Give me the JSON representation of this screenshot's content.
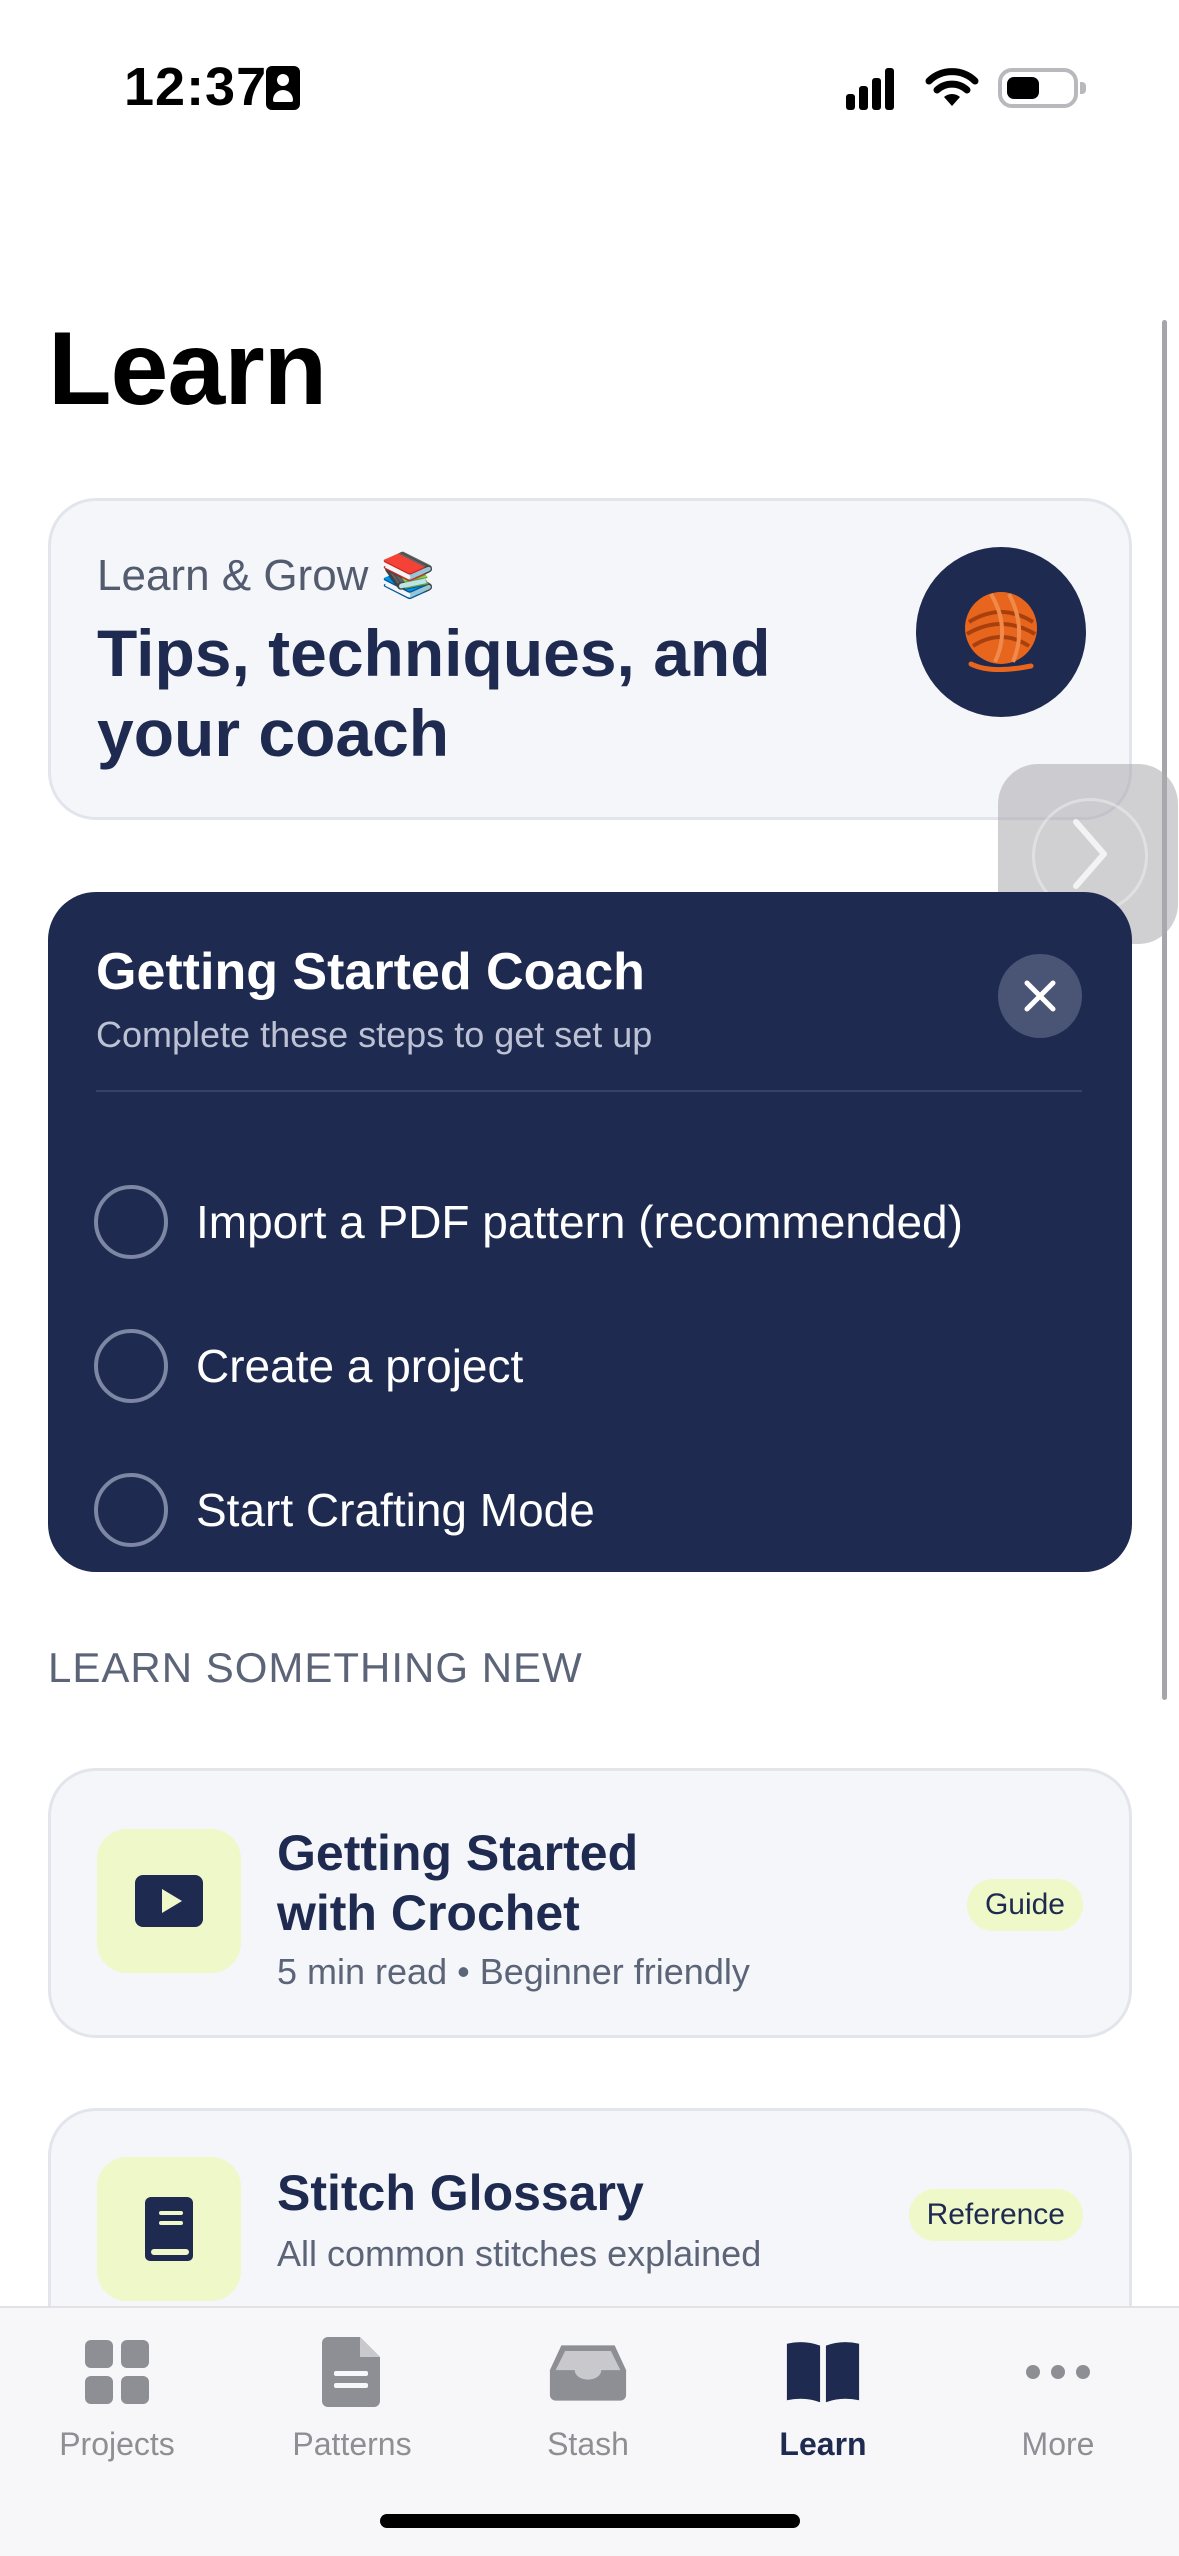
{
  "status_bar": {
    "time": "12:37"
  },
  "page": {
    "title": "Learn"
  },
  "hero": {
    "kicker": "Learn & Grow 📚",
    "title": "Tips, techniques, and your coach",
    "avatar_icon": "yarn-ball-icon"
  },
  "coach": {
    "title": "Getting Started Coach",
    "subtitle": "Complete these steps to get set up",
    "steps": [
      {
        "label": "Import a PDF pattern (recommended)",
        "done": false
      },
      {
        "label": "Create a project",
        "done": false
      },
      {
        "label": "Start Crafting Mode",
        "done": false
      }
    ]
  },
  "learn_section": {
    "header": "LEARN SOMETHING NEW",
    "items": [
      {
        "title_line1": "Getting Started",
        "title_line2": "with Crochet",
        "meta": "5 min read • Beginner friendly",
        "badge": "Guide",
        "icon": "play-icon"
      },
      {
        "title_line1": "Stitch Glossary",
        "meta": "All common stitches explained",
        "badge": "Reference",
        "icon": "book-icon"
      }
    ]
  },
  "tab_bar": {
    "tabs": [
      {
        "label": "Projects",
        "icon": "grid-icon",
        "active": false
      },
      {
        "label": "Patterns",
        "icon": "document-icon",
        "active": false
      },
      {
        "label": "Stash",
        "icon": "tray-icon",
        "active": false
      },
      {
        "label": "Learn",
        "icon": "open-book-icon",
        "active": true
      },
      {
        "label": "More",
        "icon": "ellipsis-icon",
        "active": false
      }
    ]
  },
  "colors": {
    "navy": "#1e2a4f",
    "lime": "#eef8c8",
    "card_bg": "#f5f6f9"
  }
}
